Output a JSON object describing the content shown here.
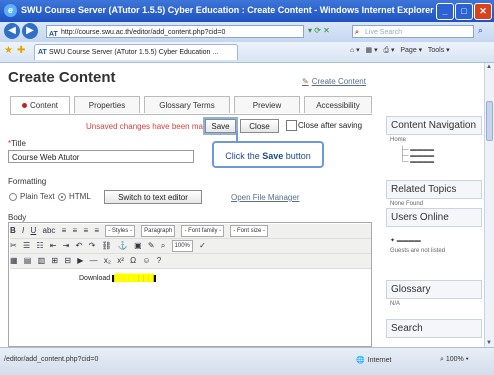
{
  "window": {
    "title": "SWU Course Server (ATutor 1.5.5) Cyber Education : Create Content - Windows Internet Explorer",
    "buttons": {
      "minimize": "_",
      "maximize": "□",
      "close": "✕"
    }
  },
  "address_bar": {
    "url": "http://course.swu.ac.th/editor/add_content.php?cid=0",
    "search_placeholder": "Live Search"
  },
  "browser_tab": {
    "label": "SWU Course Server (ATutor 1.5.5) Cyber Education ...",
    "tools": {
      "page": "Page",
      "tools": "Tools"
    }
  },
  "page": {
    "title": "Create Content",
    "create_link": "Create Content",
    "tabs": [
      {
        "label": "Content",
        "active": true
      },
      {
        "label": "Properties",
        "active": false
      },
      {
        "label": "Glossary Terms",
        "active": false
      },
      {
        "label": "Preview",
        "active": false
      },
      {
        "label": "Accessibility",
        "active": false
      }
    ],
    "unsaved_msg": "Unsaved changes have been made",
    "save_label": "Save",
    "close_label": "Close",
    "close_after_saving": "Close after saving",
    "callout_prefix": "Click the ",
    "callout_bold": "Save",
    "callout_suffix": " button",
    "title_label": "Title",
    "title_value": "Course Web Atutor",
    "formatting_label": "Formatting",
    "plain_text": "Plain Text",
    "html": "HTML",
    "switch_editor": "Switch to text editor",
    "file_manager": "Open File Manager",
    "body_label": "Body",
    "editor_selects": {
      "styles": "- Styles -",
      "paragraph": "Paragraph",
      "font_family": "- Font family -",
      "font_size": "- Font size -",
      "zoom": "100%"
    },
    "editor_content": "Download"
  },
  "sidebar": {
    "nav_title": "Content Navigation",
    "nav_home": "Home",
    "related_title": "Related Topics",
    "related_body": "None Found",
    "users_title": "Users Online",
    "users_note": "Guests are not listed",
    "glossary_title": "Glossary",
    "glossary_body": "N/A",
    "search_title": "Search"
  },
  "status_bar": {
    "url": "/editor/add_content.php?cid=0",
    "zone": "Internet",
    "zoom": "100%"
  },
  "colors": {
    "titlebar": "#1f52c1",
    "unsaved_text": "#d14040",
    "callout_border": "#6e98d6",
    "highlight": "#ffff00"
  }
}
